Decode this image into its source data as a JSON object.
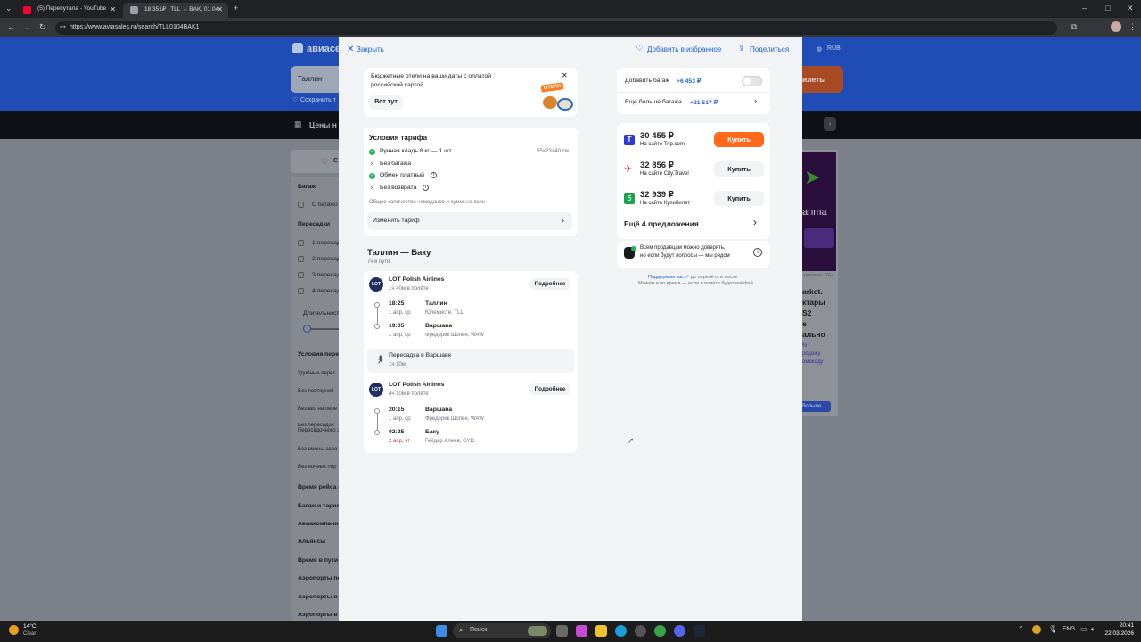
{
  "browser": {
    "tabs": [
      {
        "label": "(5) Перепутала - YouTube",
        "active": false
      },
      {
        "label": "18 351₽ | TLL → BAK, 01.04",
        "active": true
      }
    ],
    "url": "https://www.aviasales.ru/search/TLL0104BAK1"
  },
  "background_page": {
    "logo_text": "авиасе",
    "search_from": "Таллин",
    "save_text": "Сохранить т",
    "currency": "RUB",
    "tickets_button": "илеты",
    "prices_label": "Цены н",
    "filter_title": "С",
    "filters": [
      "Багаж",
      "С багажо",
      "Пересадки",
      "1 пересад",
      "2 пересад",
      "3 пересад",
      "4 пересад",
      "Длительност",
      "Условия перес",
      "Удобные перес",
      "Без повторной",
      "Без виз на пере",
      "Без пересадок Пересадочного за",
      "Без смены аэро",
      "Без ночных пер",
      "Время рейса и",
      "Багаж и тариф",
      "Авиакомпании",
      "Альянсы",
      "Время в пути",
      "Аэропорты пе",
      "Аэропорты в Т",
      "Аэропорты в Б"
    ],
    "ad_text": [
      "anma",
      "arket.",
      "ктары",
      "S2",
      "e",
      "ально"
    ],
    "ad_small": [
      "%",
      "родажу",
      "омокоду"
    ],
    "ad_button": "больше",
    "ad_tag": "реклама · 16+"
  },
  "modal": {
    "close_label": "Закрыть",
    "favorite_label": "Добавить в избранное",
    "share_label": "Поделиться",
    "promo": {
      "text": "Бюджетные отели на ваши даты с оплатой российской картой",
      "button": "Вот тут",
      "badge": "ОТЕЛИ"
    },
    "tariff": {
      "title": "Условия тарифа",
      "items": [
        {
          "label": "Ручная кладь 8 кг — 1 шт",
          "included": true,
          "extra": "55×23×40 см"
        },
        {
          "label": "Без багажа",
          "included": false
        },
        {
          "label": "Обмен платный",
          "included": true,
          "info": true
        },
        {
          "label": "Без возврата",
          "included": false,
          "info": true
        }
      ],
      "note": "Общее количество чемоданов и сумок на всех",
      "change_label": "Изменить тариф"
    },
    "route": {
      "title": "Таллин — Баку",
      "duration": "7ч в пути"
    },
    "segments": [
      {
        "airline": "LOT Polish Airlines",
        "flight_time": "1ч 40м в полёте",
        "details": "Подробнее",
        "dep_time": "18:25",
        "dep_date": "1 апр, ср",
        "dep_city": "Таллин",
        "dep_airport": "Юлемисте, TLL",
        "arr_time": "19:05",
        "arr_date": "1 апр, ср",
        "arr_city": "Варшава",
        "arr_airport": "Фредерик Шопен, WAW"
      },
      {
        "airline": "LOT Polish Airlines",
        "flight_time": "4ч 10м в полёте",
        "details": "Подробнее",
        "dep_time": "20:15",
        "dep_date": "1 апр, ср",
        "dep_city": "Варшава",
        "dep_airport": "Фредерик Шопен, WAW",
        "arr_time": "02:25",
        "arr_date": "2 апр, чт",
        "arr_city": "Баку",
        "arr_airport": "Гейдар Алиев, GYD"
      }
    ],
    "layover": {
      "label": "Пересадка в Варшаве",
      "duration": "1ч 10м"
    },
    "baggage": {
      "add_label": "Добавить багаж",
      "add_price": "+6 453 ₽",
      "more_label": "Еще больше багажа",
      "more_price": "+21 517 ₽"
    },
    "offers": [
      {
        "price": "30 455 ₽",
        "seller": "На сайте Trip.com",
        "button": "Купить",
        "primary": true,
        "logo": "T",
        "logo_color": "#2d3bd6"
      },
      {
        "price": "32 856 ₽",
        "seller": "На сайте City.Travel",
        "button": "Купить",
        "primary": false,
        "logo": "✈",
        "logo_color": "#e0243a"
      },
      {
        "price": "32 939 ₽",
        "seller": "На сайте Купибилет",
        "button": "Купить",
        "primary": false,
        "logo": "б",
        "logo_color": "#19a34a"
      }
    ],
    "more_offers": "Ещё 4 предложения",
    "trust": {
      "text1": "Всем продавцам можно доверять,",
      "text2": "но если будут вопросы — мы рядом"
    },
    "support": {
      "link": "Поддержим вас ↗",
      "line1_rest": " до перелёта и после",
      "line2": "Можем и во время — если в полёте будет вайфай"
    }
  },
  "taskbar": {
    "temp": "14°C",
    "weather": "Clear",
    "search": "Поиск",
    "lang": "ENG",
    "time": "20:41",
    "date": "22.03.2026"
  }
}
